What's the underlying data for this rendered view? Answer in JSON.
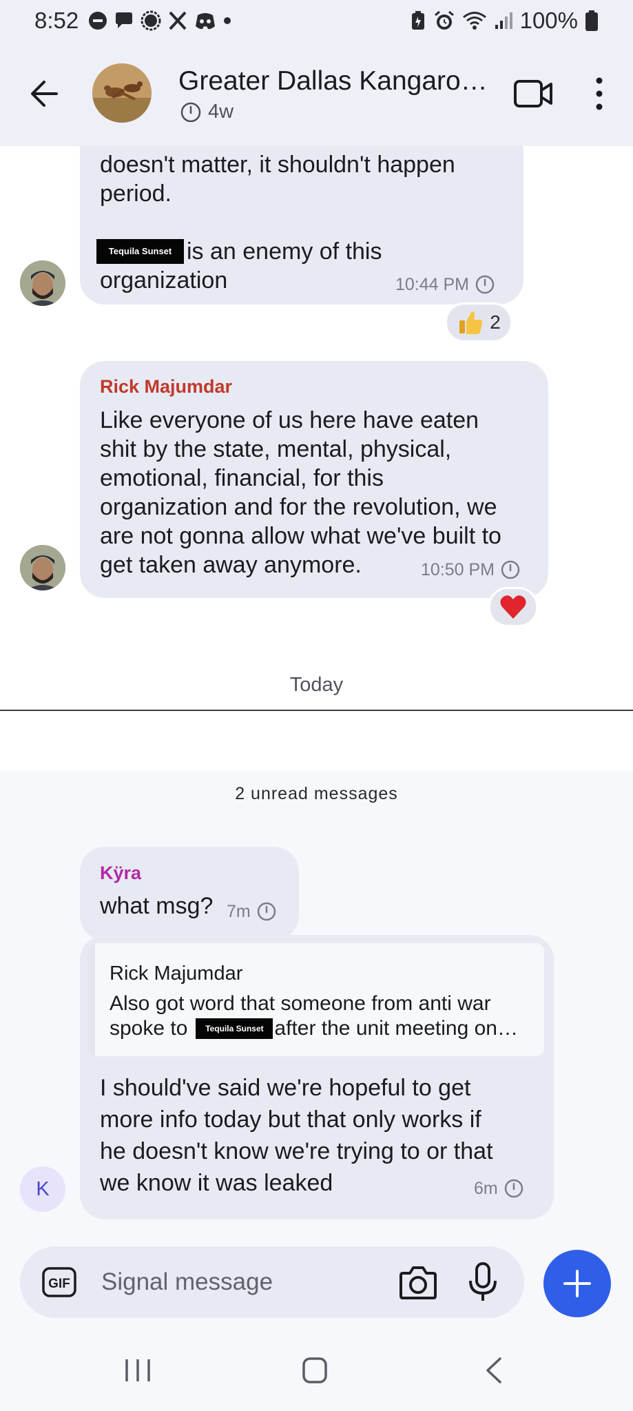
{
  "status_bar": {
    "time": "8:52",
    "battery": "100%",
    "left_icons": [
      "do-not-disturb-icon",
      "chat-bubble-icon",
      "signal-app-icon",
      "x-app-icon",
      "discord-icon",
      "dot-icon"
    ],
    "right_icons": [
      "battery-saver-icon",
      "alarm-icon",
      "wifi-icon",
      "cell-signal-icon",
      "battery-icon"
    ]
  },
  "header": {
    "group_name": "Greater Dallas Kangaro…",
    "disappearing_timer": "4w",
    "icons": [
      "back-arrow-icon",
      "video-camera-icon",
      "more-vert-icon",
      "timer-icon"
    ]
  },
  "messages": [
    {
      "id": "m1",
      "line1": "doesn't matter, it shouldn't happen",
      "line2": "period.",
      "redaction_label": "Tequila Sunset",
      "line3_after": "is an enemy of this",
      "line4": "organization",
      "time": "10:44 PM",
      "reaction_count": "2",
      "reaction_icon": "thumbs-up-icon"
    },
    {
      "id": "m2",
      "sender": "Rick Majumdar",
      "sender_color": "#c0392b",
      "lines": [
        "Like everyone of us here have eaten",
        "shit by the state, mental, physical,",
        "emotional, financial, for this",
        "organization and for the revolution, we",
        "are not gonna allow what we've built to",
        "get taken away anymore."
      ],
      "time": "10:50 PM",
      "reaction_icon": "red-heart-icon"
    }
  ],
  "date_divider": "Today",
  "unread_label": "2 unread messages",
  "unread_messages": [
    {
      "id": "m3",
      "sender": "Kÿra",
      "sender_color": "#b22aa6",
      "text": "what msg?",
      "time": "7m"
    },
    {
      "id": "m4",
      "avatar_initial": "K",
      "quote": {
        "sender": "Rick Majumdar",
        "line1": "Also got word that someone from anti war",
        "line2_before": "spoke to",
        "redaction_label": "Tequila Sunset",
        "line2_after": "after the unit meeting on…"
      },
      "lines": [
        "I should've said we're hopeful to get",
        "more info today but that only works if",
        "he doesn't know we're trying to or that",
        "we know it was leaked"
      ],
      "time": "6m"
    }
  ],
  "composer": {
    "placeholder": "Signal message",
    "gif_label": "GIF",
    "icons": [
      "gif-icon",
      "camera-icon",
      "microphone-icon",
      "plus-icon"
    ]
  },
  "nav_bar": {
    "icons": [
      "recent-apps-icon",
      "home-icon",
      "back-nav-icon"
    ]
  },
  "colors": {
    "accent": "#2f5fe9",
    "bubble": "#e8eaf3",
    "header_bg": "#eef0f8"
  }
}
